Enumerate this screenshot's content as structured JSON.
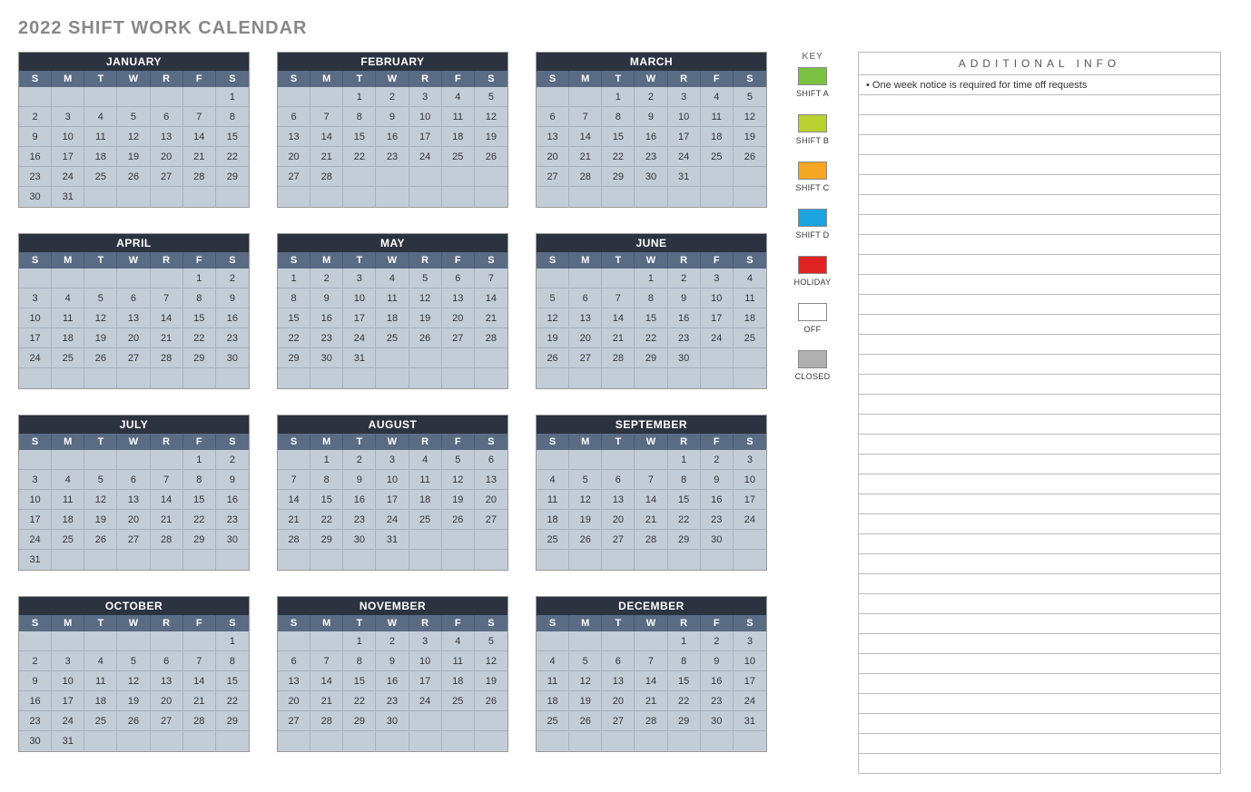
{
  "title": "2022 SHIFT WORK CALENDAR",
  "dow": [
    "S",
    "M",
    "T",
    "W",
    "R",
    "F",
    "S"
  ],
  "months": [
    {
      "name": "JANUARY",
      "startDow": 6,
      "days": 31,
      "rows": 6
    },
    {
      "name": "FEBRUARY",
      "startDow": 2,
      "days": 28,
      "rows": 6
    },
    {
      "name": "MARCH",
      "startDow": 2,
      "days": 31,
      "rows": 6
    },
    {
      "name": "APRIL",
      "startDow": 5,
      "days": 30,
      "rows": 6
    },
    {
      "name": "MAY",
      "startDow": 0,
      "days": 31,
      "rows": 6
    },
    {
      "name": "JUNE",
      "startDow": 3,
      "days": 30,
      "rows": 6
    },
    {
      "name": "JULY",
      "startDow": 5,
      "days": 31,
      "rows": 6
    },
    {
      "name": "AUGUST",
      "startDow": 1,
      "days": 31,
      "rows": 6
    },
    {
      "name": "SEPTEMBER",
      "startDow": 4,
      "days": 30,
      "rows": 6
    },
    {
      "name": "OCTOBER",
      "startDow": 6,
      "days": 31,
      "rows": 6
    },
    {
      "name": "NOVEMBER",
      "startDow": 2,
      "days": 30,
      "rows": 6
    },
    {
      "name": "DECEMBER",
      "startDow": 4,
      "days": 31,
      "rows": 6
    }
  ],
  "key": {
    "title": "KEY",
    "items": [
      {
        "label": "SHIFT A",
        "color": "#7cc242"
      },
      {
        "label": "SHIFT B",
        "color": "#b9d232"
      },
      {
        "label": "SHIFT C",
        "color": "#f5a623"
      },
      {
        "label": "SHIFT D",
        "color": "#1ba3e0"
      },
      {
        "label": "HOLIDAY",
        "color": "#e02424"
      },
      {
        "label": "OFF",
        "color": "#ffffff"
      },
      {
        "label": "CLOSED",
        "color": "#b0b0b0"
      }
    ]
  },
  "info": {
    "title": "ADDITIONAL INFO",
    "rows": [
      "• One week notice is required for time off requests",
      "",
      "",
      "",
      "",
      "",
      "",
      "",
      "",
      "",
      "",
      "",
      "",
      "",
      "",
      "",
      "",
      "",
      "",
      "",
      "",
      "",
      "",
      "",
      "",
      "",
      "",
      "",
      "",
      "",
      "",
      "",
      "",
      "",
      ""
    ]
  }
}
